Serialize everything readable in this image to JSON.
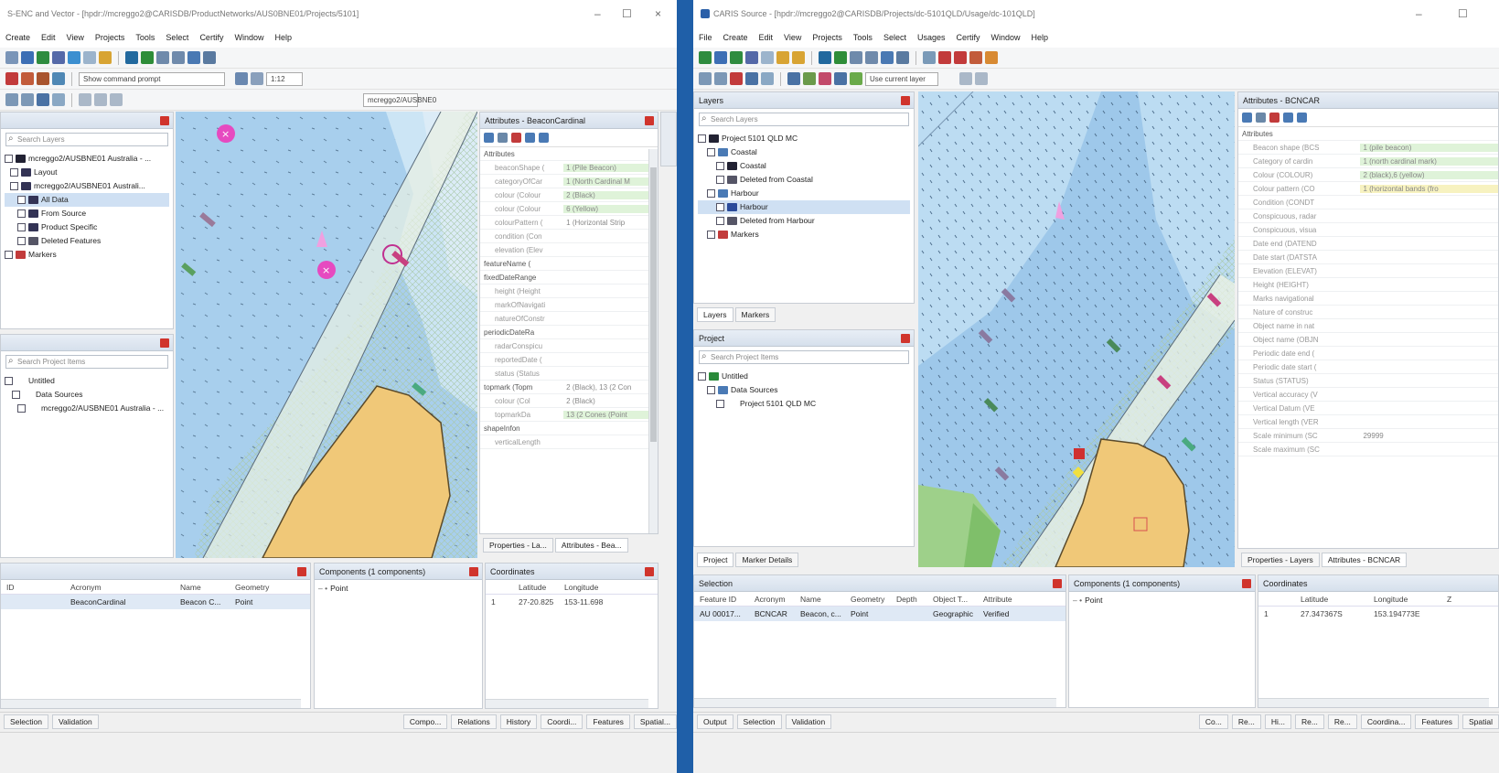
{
  "left": {
    "title": "S-ENC and Vector - [hpdr://mcreggo2@CARISDB/ProductNetworks/AUS0BNE01/Projects/5101]",
    "menu": [
      "Create",
      "Edit",
      "View",
      "Projects",
      "Tools",
      "Select",
      "Certify",
      "Window",
      "Help"
    ],
    "command_prompt": "Show command prompt",
    "scale_field": "1:12",
    "db_field": "mcreggo2/AUSBNE0",
    "layers_search": "Search Layers",
    "layers_tree": [
      "mcreggo2/AUSBNE01 Australia - ...",
      "Layout",
      "mcreggo2/AUSBNE01 Australi...",
      "All Data",
      "From Source",
      "Product Specific",
      "Deleted Features",
      "Markers"
    ],
    "project_search": "Search Project Items",
    "project_tree": [
      "Untitled",
      "Data Sources",
      "mcreggo2/AUSBNE01 Australia - ..."
    ],
    "attributes_title": "Attributes - BeaconCardinal",
    "attributes_section": "Attributes",
    "attributes": [
      {
        "k": "beaconShape (",
        "v": "1 (Pile Beacon)",
        "g": true
      },
      {
        "k": "categoryOfCar",
        "v": "1 (North Cardinal M",
        "g": true
      },
      {
        "k": "colour (Colour",
        "v": "2 (Black)",
        "g": true
      },
      {
        "k": "colour (Colour",
        "v": "6 (Yellow)",
        "g": true
      },
      {
        "k": "colourPattern (",
        "v": "1 (Horizontal Strip",
        "g": false
      },
      {
        "k": "condition (Con",
        "v": "",
        "g": false
      },
      {
        "k": "elevation (Elev",
        "v": "",
        "g": false
      },
      {
        "k": "featureName (",
        "v": "",
        "g": false,
        "s": true
      },
      {
        "k": "fixedDateRange",
        "v": "",
        "g": false,
        "s": true
      },
      {
        "k": "height (Height",
        "v": "",
        "g": false
      },
      {
        "k": "markOfNavigati",
        "v": "",
        "g": false
      },
      {
        "k": "natureOfConstr",
        "v": "",
        "g": false
      },
      {
        "k": "periodicDateRa",
        "v": "",
        "g": false,
        "s": true
      },
      {
        "k": "radarConspicu",
        "v": "",
        "g": false
      },
      {
        "k": "reportedDate (",
        "v": "",
        "g": false
      },
      {
        "k": "status (Status",
        "v": "",
        "g": false
      },
      {
        "k": "topmark (Topm",
        "v": "2 (Black), 13 (2 Con",
        "g": false,
        "s": true
      },
      {
        "k": "colour (Col",
        "v": "2 (Black)",
        "g": false
      },
      {
        "k": "topmarkDa",
        "v": "13 (2 Cones (Point",
        "g": true
      },
      {
        "k": "shapeInfon",
        "v": "",
        "g": false,
        "s": true
      },
      {
        "k": "verticalLength",
        "v": "",
        "g": false
      }
    ],
    "prop_tabs": [
      "Properties - La...",
      "Attributes - Bea..."
    ],
    "selection_headers": [
      "ID",
      "Acronym",
      "Name",
      "Geometry"
    ],
    "selection_row": [
      "",
      "BeaconCardinal",
      "Beacon C...",
      "Point"
    ],
    "components_title": "Components (1 components)",
    "components_item": "Point",
    "coordinates_title": "Coordinates",
    "coord_headers": [
      "",
      "Latitude",
      "Longitude"
    ],
    "coord_row": [
      "1",
      "27-20.825",
      "153-11.698"
    ],
    "status_tabs_left": [
      "Selection",
      "Validation"
    ],
    "status_tabs_right": [
      "Compo...",
      "Relations",
      "History",
      "Coordi...",
      "Features",
      "Spatial..."
    ]
  },
  "right": {
    "title": "CARIS Source - [hpdr://mcreggo2@CARISDB/Projects/dc-5101QLD/Usage/dc-101QLD]",
    "menu": [
      "File",
      "Create",
      "Edit",
      "View",
      "Projects",
      "Tools",
      "Select",
      "Usages",
      "Certify",
      "Window",
      "Help"
    ],
    "layer_combo": "Use current layer",
    "layers_title": "Layers",
    "layers_search": "Search Layers",
    "layers_tree": [
      "Project 5101 QLD MC",
      "Coastal",
      "Coastal",
      "Deleted from Coastal",
      "Harbour",
      "Harbour",
      "Deleted from Harbour",
      "Markers"
    ],
    "layer_tabs": [
      "Layers",
      "Markers"
    ],
    "project_title": "Project",
    "project_search": "Search Project Items",
    "project_tree": [
      "Untitled",
      "Data Sources",
      "Project 5101 QLD MC"
    ],
    "project_tabs": [
      "Project",
      "Marker Details"
    ],
    "attributes_title": "Attributes - BCNCAR",
    "attributes_section": "Attributes",
    "attributes": [
      {
        "k": "Beacon shape (BCS",
        "v": "1 (pile beacon)",
        "g": true
      },
      {
        "k": "Category of cardin",
        "v": "1 (north cardinal mark)",
        "g": true
      },
      {
        "k": "Colour (COLOUR)",
        "v": "2 (black),6 (yellow)",
        "g": true
      },
      {
        "k": "Colour pattern (CO",
        "v": "1 (horizontal bands (fro",
        "y": true
      },
      {
        "k": "Condition (CONDT",
        "v": ""
      },
      {
        "k": "Conspicuous, radar",
        "v": ""
      },
      {
        "k": "Conspicuous, visua",
        "v": ""
      },
      {
        "k": "Date end (DATEND",
        "v": ""
      },
      {
        "k": "Date start (DATSTA",
        "v": ""
      },
      {
        "k": "Elevation (ELEVAT)",
        "v": ""
      },
      {
        "k": "Height (HEIGHT)",
        "v": ""
      },
      {
        "k": "Marks navigational",
        "v": ""
      },
      {
        "k": "Nature of construc",
        "v": ""
      },
      {
        "k": "Object name in nat",
        "v": ""
      },
      {
        "k": "Object name (OBJN",
        "v": ""
      },
      {
        "k": "Periodic date end (",
        "v": ""
      },
      {
        "k": "Periodic date start (",
        "v": ""
      },
      {
        "k": "Status (STATUS)",
        "v": ""
      },
      {
        "k": "Vertical accuracy (V",
        "v": ""
      },
      {
        "k": "Vertical Datum (VE",
        "v": ""
      },
      {
        "k": "Vertical length (VER",
        "v": ""
      },
      {
        "k": "Scale minimum (SC",
        "v": "29999"
      },
      {
        "k": "Scale maximum (SC",
        "v": ""
      }
    ],
    "prop_tabs": [
      "Properties - Layers",
      "Attributes - BCNCAR"
    ],
    "selection_title": "Selection",
    "selection_headers": [
      "Feature ID",
      "Acronym",
      "Name",
      "Geometry",
      "Depth",
      "Object T...",
      "Attribute"
    ],
    "selection_row": [
      "AU 00017...",
      "BCNCAR",
      "Beacon, c...",
      "Point",
      "",
      "Geographic",
      "Verified"
    ],
    "components_title": "Components (1 components)",
    "components_item": "Point",
    "coordinates_title": "Coordinates",
    "coord_headers": [
      "",
      "Latitude",
      "Longitude",
      "Z"
    ],
    "coord_row": [
      "1",
      "27.347367S",
      "153.194773E"
    ],
    "status_tabs_left": [
      "Output",
      "Selection",
      "Validation"
    ],
    "status_tabs_right": [
      "Co...",
      "Re...",
      "Hi...",
      "Re...",
      "Re...",
      "Coordina...",
      "Features",
      "Spatial"
    ]
  }
}
